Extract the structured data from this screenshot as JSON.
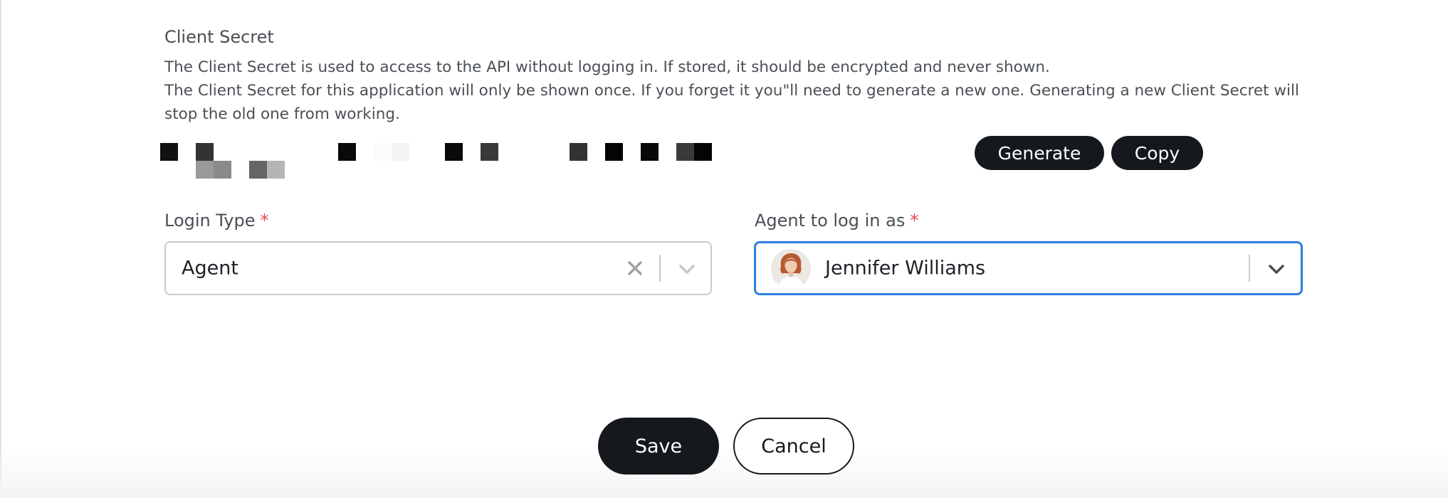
{
  "client_secret": {
    "title": "Client Secret",
    "description_line1": "The Client Secret is used to access to the API without logging in. If stored, it should be encrypted and never shown.",
    "description_line2": "The Client Secret for this application will only be shown once. If you forget it you\"ll need to generate a new one. Generating a new Client Secret will stop the old one from working.",
    "generate_label": "Generate",
    "copy_label": "Copy"
  },
  "login_type": {
    "label": "Login Type",
    "required_mark": "*",
    "value": "Agent"
  },
  "agent": {
    "label": "Agent to log in as",
    "required_mark": "*",
    "value": "Jennifer Williams"
  },
  "footer": {
    "save_label": "Save",
    "cancel_label": "Cancel"
  },
  "colors": {
    "primary_button": "#15191e",
    "focus_border": "#2e7fdf",
    "required": "#e5484d"
  },
  "icons": {
    "clear": "close-icon",
    "dropdown": "chevron-down-icon"
  }
}
